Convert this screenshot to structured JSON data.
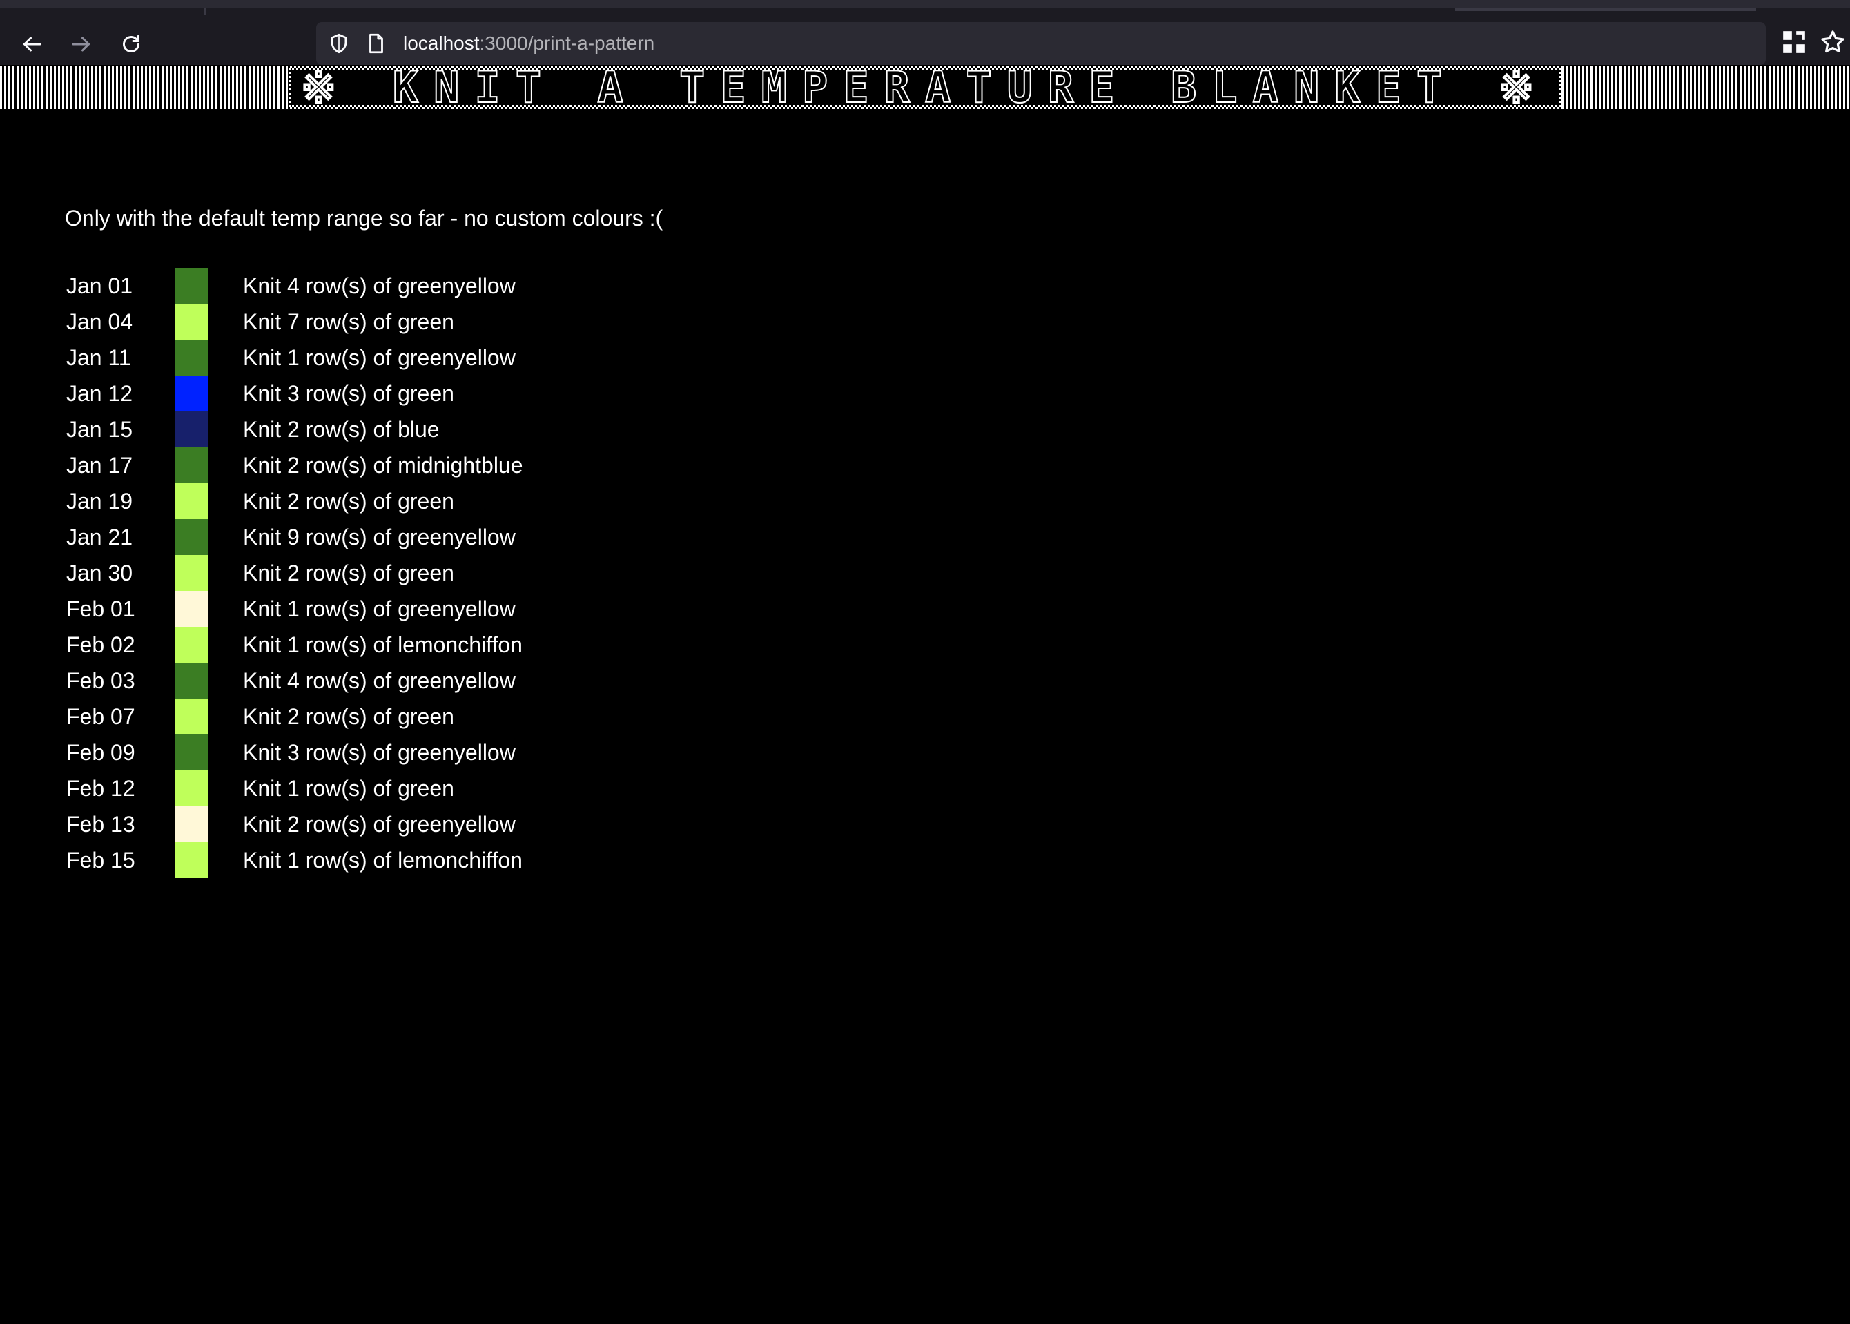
{
  "browser": {
    "url_host": "localhost",
    "url_path": ":3000/print-a-pattern"
  },
  "banner": {
    "title": "※ KNIT A TEMPERATURE BLANKET ※"
  },
  "intro": "Only with the default temp range so far - no custom colours :(",
  "colors": {
    "green": "#3b7d23",
    "greenyellow": "#bfff5a",
    "blue": "#0022ff",
    "midnightblue": "#17206b",
    "lemonchiffon": "#fff8d8"
  },
  "rows": [
    {
      "date": "Jan 01",
      "swatch": "#3b7d23",
      "text": "Knit 4 row(s) of greenyellow"
    },
    {
      "date": "Jan 04",
      "swatch": "#bfff5a",
      "text": "Knit 7 row(s) of green"
    },
    {
      "date": "Jan 11",
      "swatch": "#3b7d23",
      "text": "Knit 1 row(s) of greenyellow"
    },
    {
      "date": "Jan 12",
      "swatch": "#0022ff",
      "text": "Knit 3 row(s) of green"
    },
    {
      "date": "Jan 15",
      "swatch": "#17206b",
      "text": "Knit 2 row(s) of blue"
    },
    {
      "date": "Jan 17",
      "swatch": "#3b7d23",
      "text": "Knit 2 row(s) of midnightblue"
    },
    {
      "date": "Jan 19",
      "swatch": "#bfff5a",
      "text": "Knit 2 row(s) of green"
    },
    {
      "date": "Jan 21",
      "swatch": "#3b7d23",
      "text": "Knit 9 row(s) of greenyellow"
    },
    {
      "date": "Jan 30",
      "swatch": "#bfff5a",
      "text": "Knit 2 row(s) of green"
    },
    {
      "date": "Feb 01",
      "swatch": "#fff8d8",
      "text": "Knit 1 row(s) of greenyellow"
    },
    {
      "date": "Feb 02",
      "swatch": "#bfff5a",
      "text": "Knit 1 row(s) of lemonchiffon"
    },
    {
      "date": "Feb 03",
      "swatch": "#3b7d23",
      "text": "Knit 4 row(s) of greenyellow"
    },
    {
      "date": "Feb 07",
      "swatch": "#bfff5a",
      "text": "Knit 2 row(s) of green"
    },
    {
      "date": "Feb 09",
      "swatch": "#3b7d23",
      "text": "Knit 3 row(s) of greenyellow"
    },
    {
      "date": "Feb 12",
      "swatch": "#bfff5a",
      "text": "Knit 1 row(s) of green"
    },
    {
      "date": "Feb 13",
      "swatch": "#fff8d8",
      "text": "Knit 2 row(s) of greenyellow"
    },
    {
      "date": "Feb 15",
      "swatch": "#bfff5a",
      "text": "Knit 1 row(s) of lemonchiffon"
    }
  ]
}
